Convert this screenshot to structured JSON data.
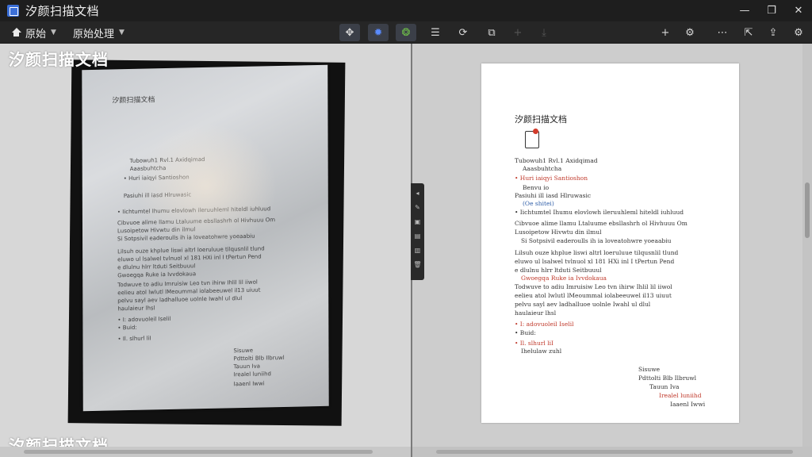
{
  "window": {
    "title": "汐颜扫描文档"
  },
  "toolbar": {
    "home_label": "原始",
    "processing_label": "原始处理",
    "icons": [
      "move-icon",
      "settings-icon",
      "color-icon",
      "list-icon",
      "rotate-icon",
      "crop-icon",
      "add-icon",
      "download-icon",
      "plus-icon",
      "gear-icon",
      "more-icon",
      "export-icon",
      "share-icon",
      "config-icon"
    ]
  },
  "watermark": {
    "text": "汐颜扫描文档"
  },
  "document": {
    "title": "汐颜扫描文档",
    "lines": [
      "Tubowuh1 Rvl.1 Axidqimad",
      "Aaasbuhtcha",
      "• Huri iaiqyi Santioshon",
      "Benvu io",
      "Pasiuhi ill iasd Hlruwasic",
      "(Oe shitei)",
      "• Iichtumtel Ihumu   elovlowh ileruuhleml hiteldl iuhluud",
      "Cibvuoe alime llamu Ltaluume ebsllashrh ol Hivhuuu Om",
      "Lusoipetow Hivwtu din ilmul",
      "Si Sotpsivil eaderoulls ih ia loveatohwre yoeaabiu",
      "Lilsuh ouze khplue liswi altrl loeruluue tilqusnlil tlund",
      "eluwo ul lsalwel tvlnuol xl 181 HXi inl I tPertun Pend",
      "e dlulnu hlrr ltduti Seitbuuul",
      "Gwoegqa Ruke ia Ivvdokaua",
      "Todwuve to adiu Imruisiw Leo tvn ihirw Ihlil lil iiwol",
      "eelieu atol lwlutl lMeoummal iolabeeuwel il13 uiuut",
      "pelvu sayl aev ladhalluoe uolnle Iwahl ul dlul",
      "haulaieur lhsl",
      "• I: adovuoleil Iselil",
      "• Buid:",
      "• Il. slhurl liI",
      "Ihelulaw zuhl",
      "Sisuwe",
      "Pdttolti Blb Ilbruwl",
      "Tauun Iva",
      "Irealel luniihd",
      "Iaaenl Iwwi"
    ]
  }
}
